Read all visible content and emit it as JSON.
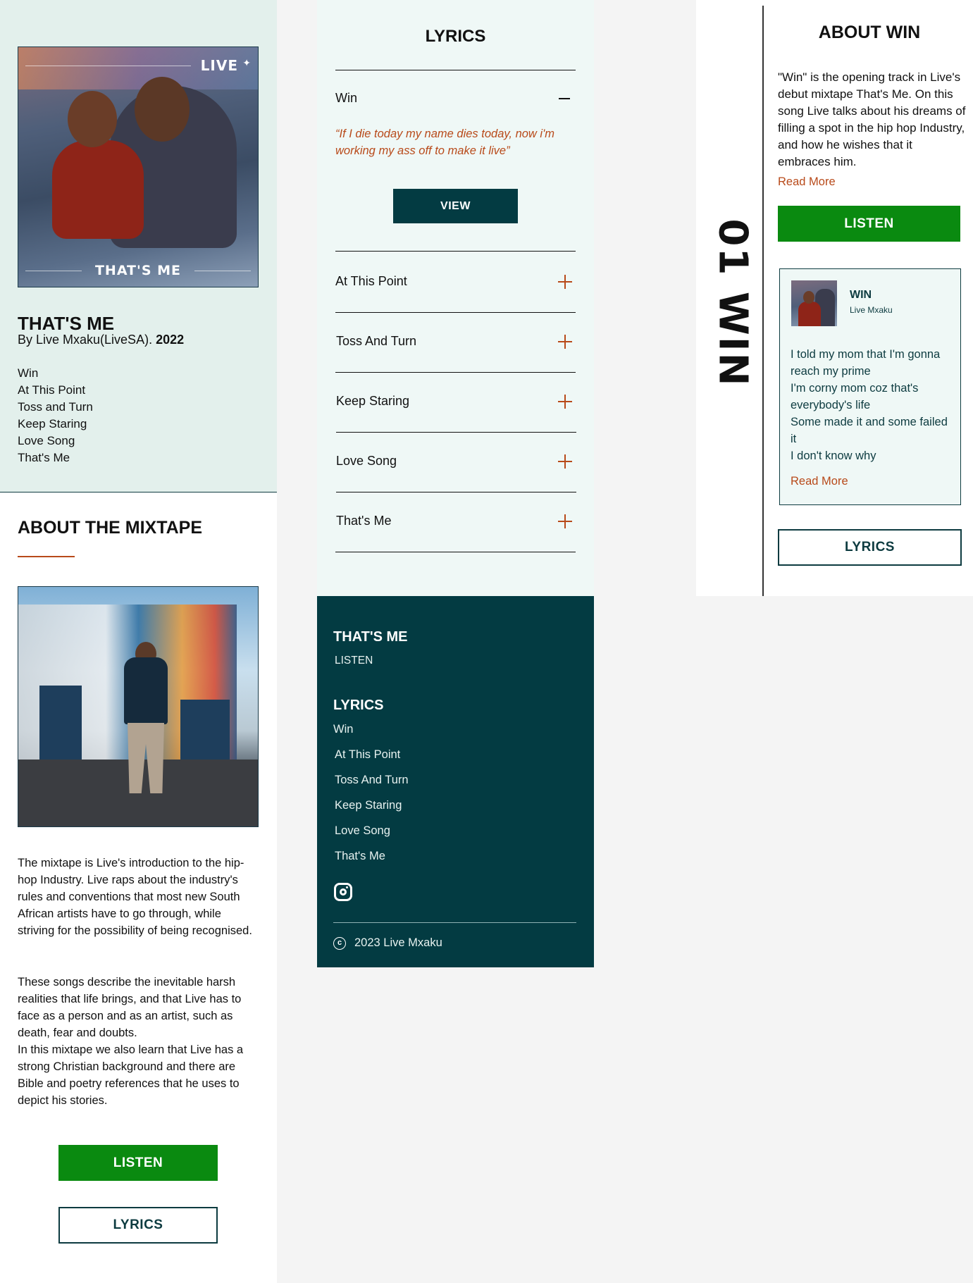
{
  "album": {
    "cover_brand": "LIVE",
    "cover_title": "THAT'S ME",
    "title": "THAT'S ME",
    "byline": "By Live Mxaku(LiveSA).",
    "year": "2022",
    "tracks": [
      "Win",
      "At This Point",
      "Toss and Turn",
      "Keep Staring",
      "Love Song",
      "That's Me"
    ]
  },
  "mixtape": {
    "heading": "ABOUT THE MIXTAPE",
    "para1": "The mixtape is Live's introduction to the hip-hop Industry. Live raps about the industry's rules and conventions that most new South African artists have to go through, while striving for the possibility of being recognised.",
    "para2": "These songs describe the inevitable harsh realities that life brings, and that Live has to face as a person and as an artist, such as death, fear and doubts.",
    "para3": "In this mixtape we also learn that Live has a strong Christian background and there are Bible and poetry references that he uses to depict his stories.",
    "listen_label": "LISTEN",
    "lyrics_label": "LYRICS"
  },
  "lyrics_panel": {
    "title": "LYRICS",
    "open_item": "Win",
    "quote": "“If I die today my name dies today, now i'm working my ass off to make it live”",
    "view_label": "VIEW",
    "items": [
      "At This Point",
      "Toss And Turn",
      "Keep Staring",
      "Love Song",
      "That's Me"
    ]
  },
  "footer": {
    "heading1": "THAT'S ME",
    "listen": "LISTEN",
    "heading2": "LYRICS",
    "links": [
      "Win",
      "At This Point",
      "Toss And Turn",
      "Keep Staring",
      "Love Song",
      "That's Me"
    ],
    "copyright": "2023 Live Mxaku",
    "icons": [
      "instagram-icon",
      "copyright-icon"
    ]
  },
  "song": {
    "vertical_label": "01 WIN",
    "heading": "ABOUT WIN",
    "about": "\"Win\" is the opening track in Live's debut mixtape That's Me. On this song Live talks about his dreams of filling a spot in the hip hop Industry, and how he wishes that it embraces him.",
    "read_more": "Read More",
    "listen_label": "LISTEN",
    "card_title": "WIN",
    "card_artist": "Live Mxaku",
    "card_lyrics": [
      "I told my mom that I'm gonna reach my prime",
      "I'm corny mom coz that's everybody's life",
      "Some made it and some failed it",
      "I don't know why"
    ],
    "card_read_more": "Read More",
    "lyrics_label": "LYRICS"
  },
  "colors": {
    "dark_teal": "#033b42",
    "green": "#0a8a10",
    "accent": "#b84a1a",
    "mint": "#e3f0ec"
  }
}
